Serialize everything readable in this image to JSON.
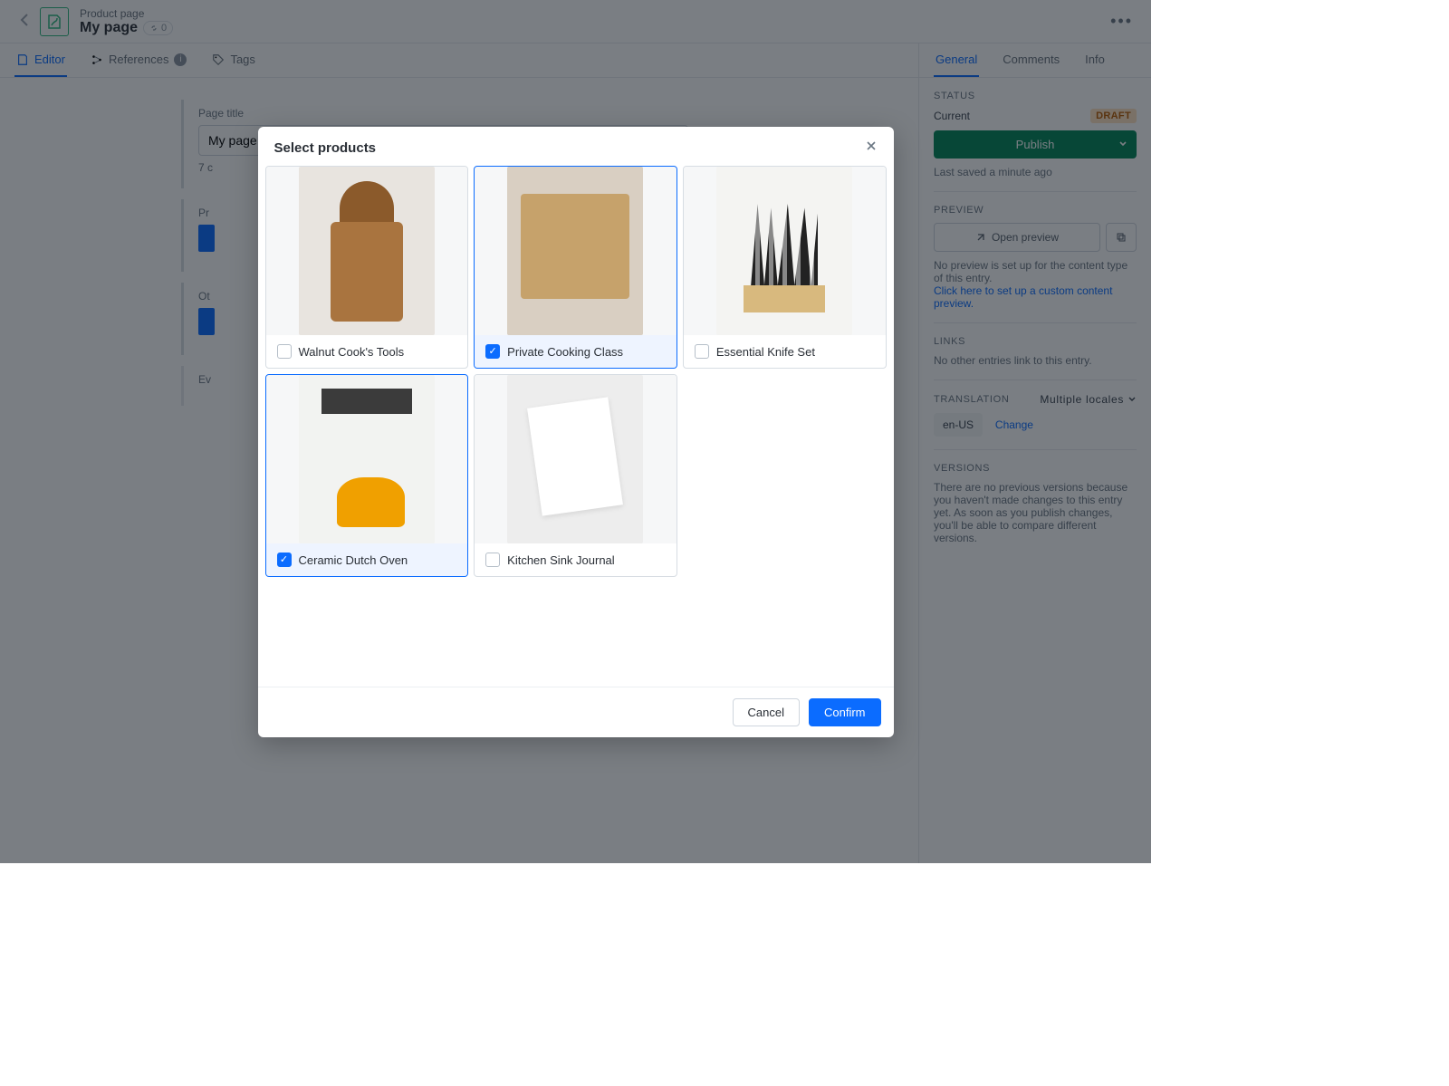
{
  "header": {
    "supertitle": "Product page",
    "title": "My page",
    "link_count": "0"
  },
  "tabs": {
    "main": [
      {
        "label": "Editor",
        "active": true
      },
      {
        "label": "References",
        "badge": "i"
      },
      {
        "label": "Tags"
      }
    ],
    "side": [
      {
        "label": "General",
        "active": true
      },
      {
        "label": "Comments"
      },
      {
        "label": "Info"
      }
    ]
  },
  "form": {
    "page_title_label": "Page title",
    "page_title_value": "My page",
    "char_hint": "7 c",
    "products_label": "Pr",
    "other_label": "Ot",
    "events_label": "Ev"
  },
  "sidebar": {
    "status_title": "STATUS",
    "current_label": "Current",
    "status_badge": "DRAFT",
    "publish_label": "Publish",
    "last_saved": "Last saved a minute ago",
    "preview_title": "PREVIEW",
    "open_preview": "Open preview",
    "preview_note": "No preview is set up for the content type of this entry.",
    "preview_link": "Click here to set up a custom content preview.",
    "links_title": "LINKS",
    "links_note": "No other entries link to this entry.",
    "translation_title": "TRANSLATION",
    "multiple_locales": "Multiple locales",
    "locale_chip": "en-US",
    "change_link": "Change",
    "versions_title": "VERSIONS",
    "versions_note": "There are no previous versions because you haven't made changes to this entry yet. As soon as you publish changes, you'll be able to compare different versions."
  },
  "modal": {
    "title": "Select products",
    "cancel": "Cancel",
    "confirm": "Confirm",
    "products": [
      {
        "name": "Walnut Cook's Tools",
        "selected": false
      },
      {
        "name": "Private Cooking Class",
        "selected": true
      },
      {
        "name": "Essential Knife Set",
        "selected": false
      },
      {
        "name": "Ceramic Dutch Oven",
        "selected": true
      },
      {
        "name": "Kitchen Sink Journal",
        "selected": false
      }
    ]
  }
}
